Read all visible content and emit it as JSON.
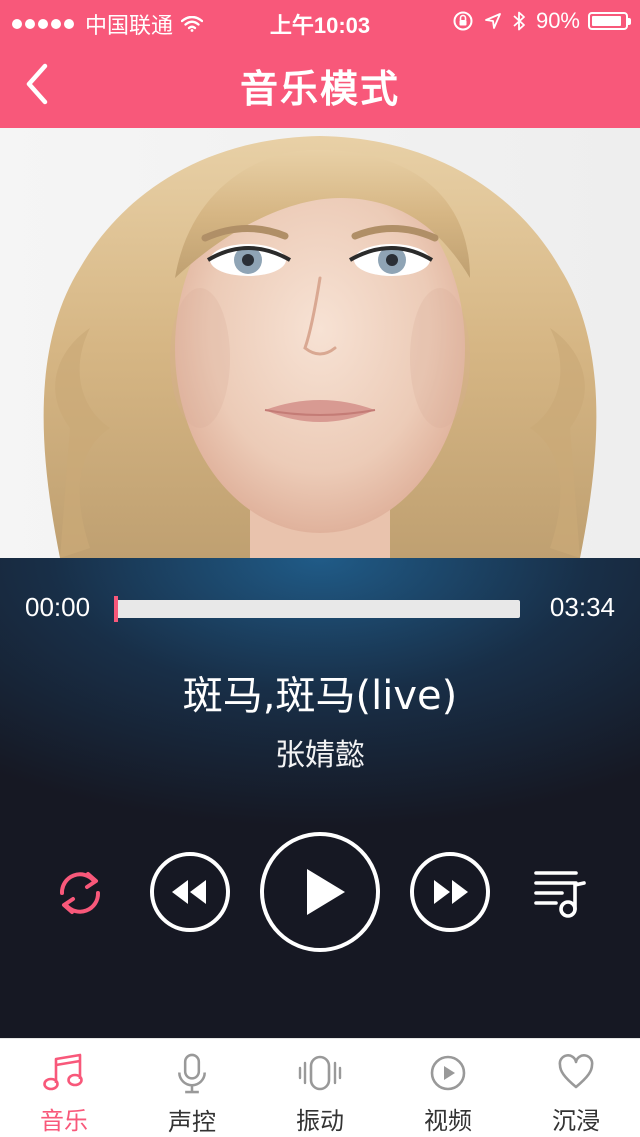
{
  "status_bar": {
    "carrier": "中国联通",
    "time": "上午10:03",
    "battery": "90%",
    "battery_level": 0.9
  },
  "header": {
    "title": "音乐模式",
    "back_icon": "chevron-left-icon"
  },
  "artwork": {
    "description": "album-cover-portrait"
  },
  "player": {
    "current_time": "00:00",
    "total_time": "03:34",
    "progress": 0.0,
    "song_title": "斑马,斑马(live)",
    "artist": "张婧懿",
    "controls": {
      "repeat_icon": "repeat-icon",
      "prev_icon": "rewind-icon",
      "play_icon": "play-icon",
      "next_icon": "fast-forward-icon",
      "playlist_icon": "playlist-icon"
    }
  },
  "tabs": [
    {
      "label": "音乐",
      "icon": "music-note-icon",
      "active": true
    },
    {
      "label": "声控",
      "icon": "microphone-icon",
      "active": false
    },
    {
      "label": "振动",
      "icon": "vibrate-icon",
      "active": false
    },
    {
      "label": "视频",
      "icon": "video-play-icon",
      "active": false
    },
    {
      "label": "沉浸",
      "icon": "heart-icon",
      "active": false
    }
  ],
  "colors": {
    "accent": "#f8587a",
    "player_bg": "#1b2433"
  }
}
